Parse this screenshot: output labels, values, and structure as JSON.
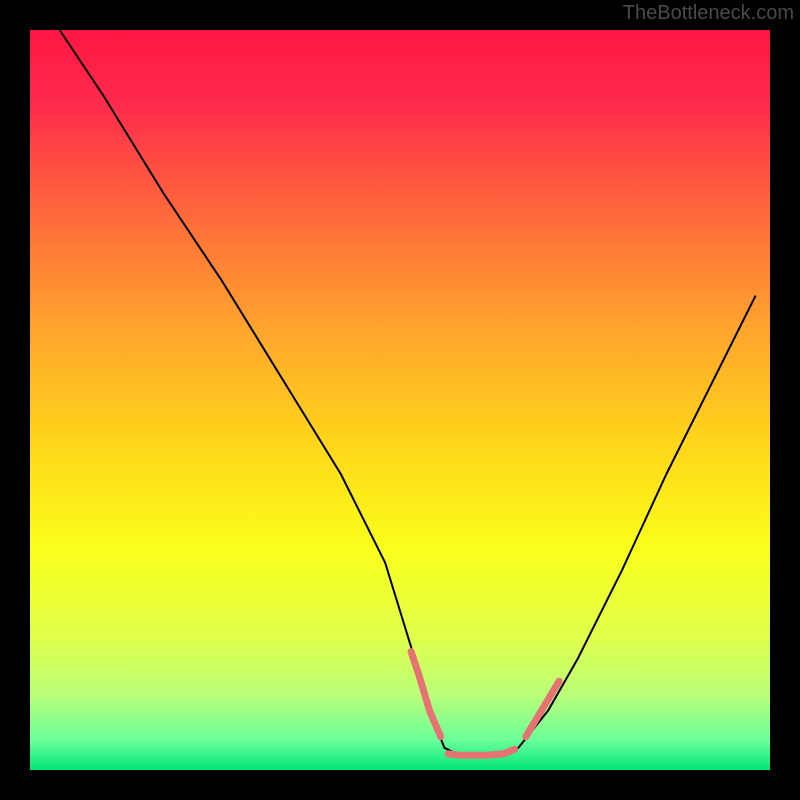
{
  "watermark": "TheBottleneck.com",
  "chart_data": {
    "type": "line",
    "title": "",
    "xlabel": "",
    "ylabel": "",
    "xlim": [
      0,
      100
    ],
    "ylim": [
      0,
      100
    ],
    "grid": false,
    "gradient_stops": [
      {
        "offset": 0.0,
        "color": "#ff1744"
      },
      {
        "offset": 0.1,
        "color": "#ff2a4d"
      },
      {
        "offset": 0.25,
        "color": "#ff6a3a"
      },
      {
        "offset": 0.4,
        "color": "#ffa32e"
      },
      {
        "offset": 0.55,
        "color": "#ffd31a"
      },
      {
        "offset": 0.7,
        "color": "#faff1a"
      },
      {
        "offset": 0.82,
        "color": "#e0ff4a"
      },
      {
        "offset": 0.9,
        "color": "#b8ff7a"
      },
      {
        "offset": 0.96,
        "color": "#6aff9a"
      },
      {
        "offset": 1.0,
        "color": "#00e676"
      }
    ],
    "series": [
      {
        "name": "bottleneck-curve",
        "stroke": "#000000",
        "stroke_width": 2,
        "x": [
          4,
          10,
          18,
          26,
          34,
          42,
          48,
          52,
          54,
          56,
          58,
          63,
          66,
          70,
          74,
          80,
          86,
          92,
          98
        ],
        "y": [
          100,
          91,
          78,
          66,
          53,
          40,
          28,
          15,
          8,
          3,
          2,
          2,
          3,
          8,
          15,
          27,
          40,
          52,
          64
        ]
      }
    ],
    "highlight_segments": [
      {
        "name": "left-descent-highlight",
        "stroke": "#e57373",
        "stroke_width": 7,
        "x": [
          51.5,
          52.5,
          54,
          55.5
        ],
        "y": [
          16,
          13,
          8,
          4.5
        ]
      },
      {
        "name": "flat-bottom-highlight",
        "stroke": "#e57373",
        "stroke_width": 7,
        "x": [
          56.5,
          58,
          60,
          62,
          64,
          65.5
        ],
        "y": [
          2.2,
          2,
          2,
          2,
          2.2,
          2.8
        ]
      },
      {
        "name": "right-ascent-highlight",
        "stroke": "#e57373",
        "stroke_width": 7,
        "x": [
          67,
          68.5,
          70,
          71.5
        ],
        "y": [
          4.5,
          7,
          9.5,
          12
        ]
      }
    ]
  }
}
